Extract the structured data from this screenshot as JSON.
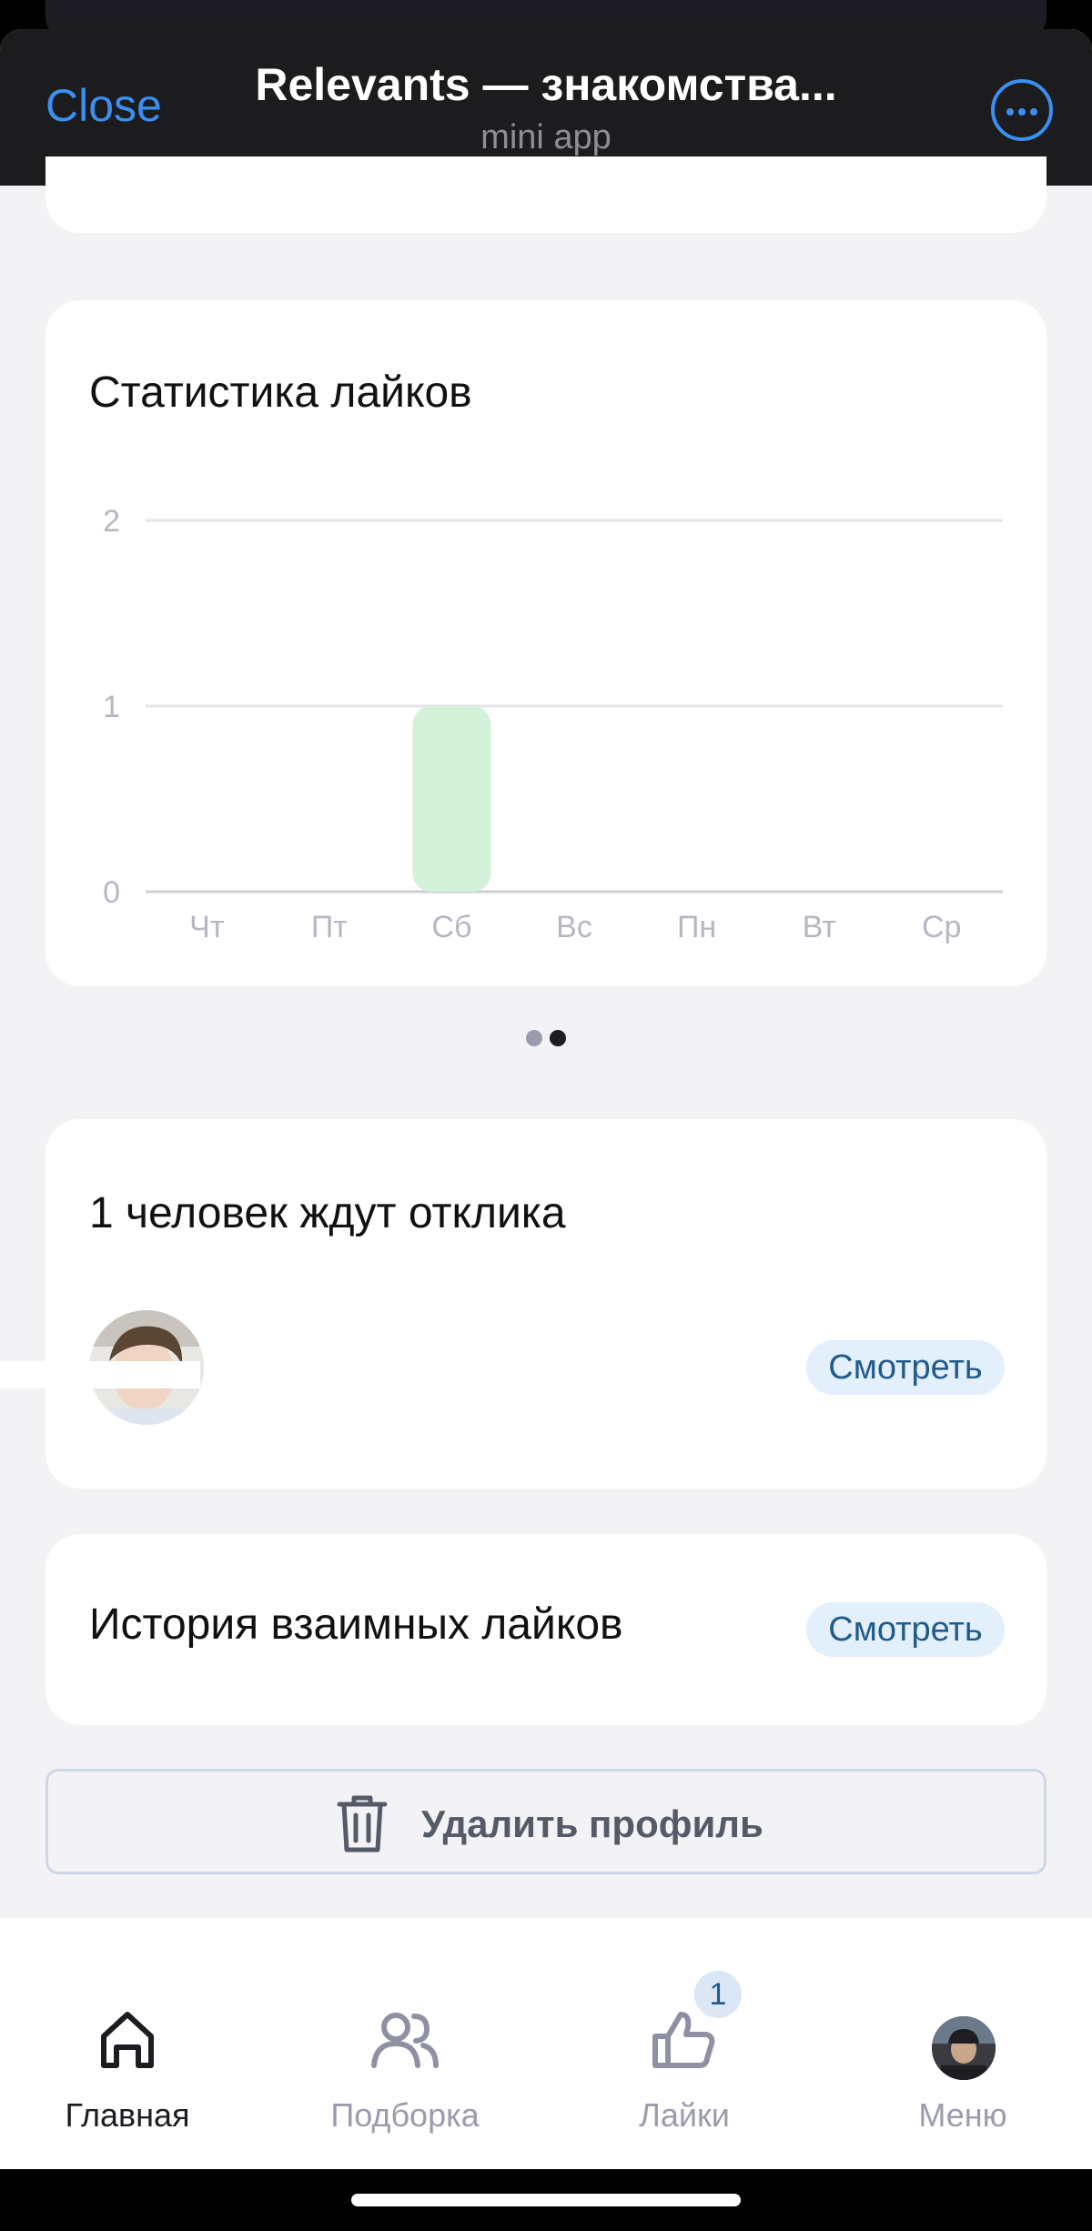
{
  "header": {
    "close_label": "Close",
    "title": "Relevants — знакомства...",
    "subtitle": "mini app",
    "more_icon": "ellipsis-circle-icon"
  },
  "stats": {
    "title": "Статистика лайков"
  },
  "chart_data": {
    "type": "bar",
    "categories": [
      "Чт",
      "Пт",
      "Сб",
      "Вс",
      "Пн",
      "Вт",
      "Ср"
    ],
    "values": [
      0,
      0,
      1,
      0,
      0,
      0,
      0
    ],
    "yticks": [
      "0",
      "1",
      "2"
    ],
    "ylim": [
      0,
      2
    ],
    "grid": true,
    "bar_color": "#d4f2d9"
  },
  "carousel": {
    "pages": 2,
    "active_page": 2
  },
  "waiting": {
    "title": "1 человек ждут отклика",
    "view_label": "Смотреть"
  },
  "history": {
    "title": "История взаимных лайков",
    "view_label": "Смотреть"
  },
  "delete_profile": {
    "label": "Удалить профиль",
    "icon": "trash-icon"
  },
  "tabbar": {
    "items": [
      {
        "label": "Главная",
        "icon": "home-icon",
        "active": true
      },
      {
        "label": "Подборка",
        "icon": "users-icon",
        "active": false
      },
      {
        "label": "Лайки",
        "icon": "thumbs-up-icon",
        "active": false,
        "badge": "1"
      },
      {
        "label": "Меню",
        "icon": "avatar-icon",
        "active": false
      }
    ]
  },
  "colors": {
    "accent": "#3a8ff0",
    "view_button_bg": "#e3effa",
    "view_button_text": "#1f5b8c"
  }
}
